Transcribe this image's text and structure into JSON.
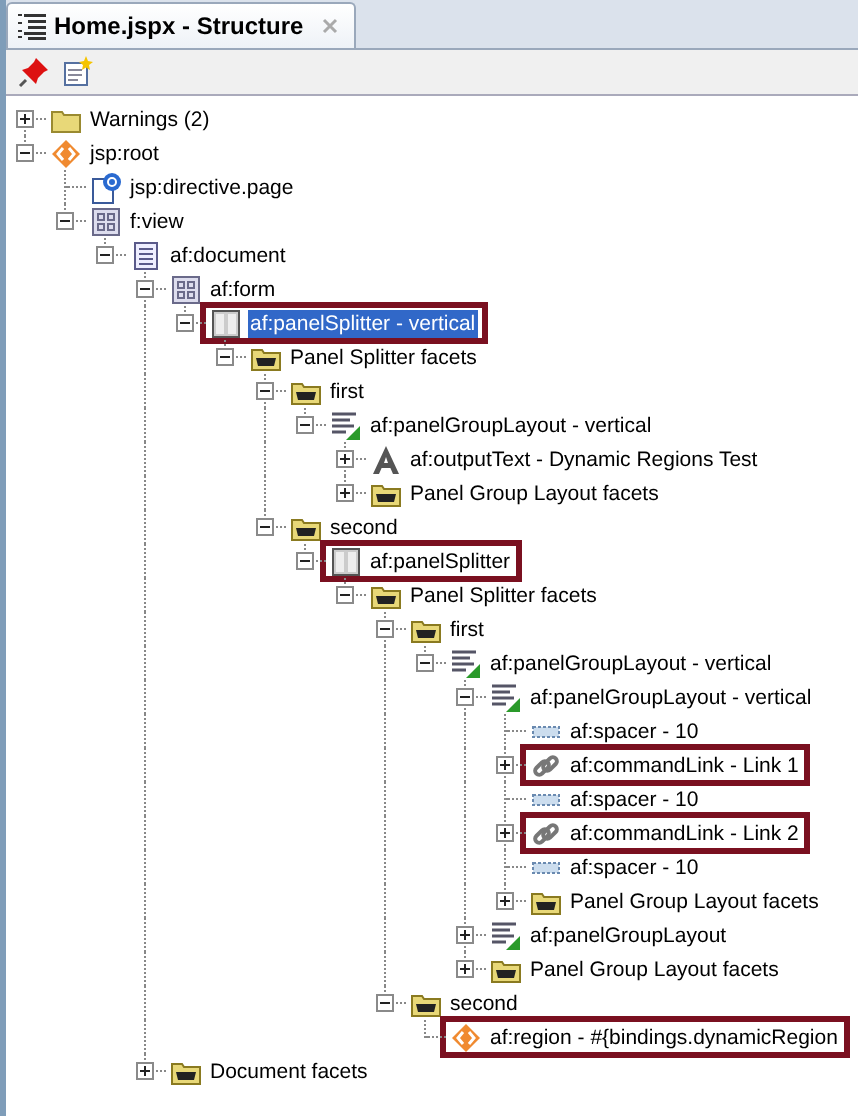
{
  "panel": {
    "title": "Home.jspx - Structure"
  },
  "tree": [
    {
      "label": "Warnings (2)",
      "kind": "folder",
      "expanded": false,
      "selected": false,
      "flagged": false
    },
    {
      "label": "jsp:root",
      "kind": "tag",
      "expanded": true,
      "selected": false,
      "flagged": false,
      "children": [
        {
          "label": "jsp:directive.page",
          "kind": "directive",
          "selected": false,
          "flagged": false
        },
        {
          "label": "f:view",
          "kind": "grid",
          "expanded": true,
          "selected": false,
          "flagged": false,
          "children": [
            {
              "label": "af:document",
              "kind": "doc",
              "expanded": true,
              "selected": false,
              "flagged": false,
              "children": [
                {
                  "label": "af:form",
                  "kind": "grid",
                  "expanded": true,
                  "selected": false,
                  "flagged": false,
                  "children": [
                    {
                      "label": "af:panelSplitter - vertical",
                      "kind": "splitter",
                      "expanded": true,
                      "selected": true,
                      "flagged": true,
                      "children": [
                        {
                          "label": "Panel Splitter facets",
                          "kind": "facet",
                          "expanded": true,
                          "selected": false,
                          "flagged": false,
                          "children": [
                            {
                              "label": "first",
                              "kind": "facet",
                              "expanded": true,
                              "selected": false,
                              "flagged": false,
                              "children": [
                                {
                                  "label": "af:panelGroupLayout - vertical",
                                  "kind": "layout",
                                  "expanded": true,
                                  "selected": false,
                                  "flagged": false,
                                  "children": [
                                    {
                                      "label": "af:outputText - Dynamic Regions Test",
                                      "kind": "text",
                                      "expanded": false,
                                      "selected": false,
                                      "flagged": false
                                    },
                                    {
                                      "label": "Panel Group Layout facets",
                                      "kind": "facet",
                                      "expanded": false,
                                      "selected": false,
                                      "flagged": false
                                    }
                                  ]
                                }
                              ]
                            },
                            {
                              "label": "second",
                              "kind": "facet",
                              "expanded": true,
                              "selected": false,
                              "flagged": false,
                              "children": [
                                {
                                  "label": "af:panelSplitter",
                                  "kind": "splitter",
                                  "expanded": true,
                                  "selected": false,
                                  "flagged": true,
                                  "children": [
                                    {
                                      "label": "Panel Splitter facets",
                                      "kind": "facet",
                                      "expanded": true,
                                      "selected": false,
                                      "flagged": false,
                                      "children": [
                                        {
                                          "label": "first",
                                          "kind": "facet",
                                          "expanded": true,
                                          "selected": false,
                                          "flagged": false,
                                          "children": [
                                            {
                                              "label": "af:panelGroupLayout - vertical",
                                              "kind": "layout",
                                              "expanded": true,
                                              "selected": false,
                                              "flagged": false,
                                              "children": [
                                                {
                                                  "label": "af:panelGroupLayout - vertical",
                                                  "kind": "layout",
                                                  "expanded": true,
                                                  "selected": false,
                                                  "flagged": false,
                                                  "children": [
                                                    {
                                                      "label": "af:spacer - 10",
                                                      "kind": "spacer",
                                                      "selected": false,
                                                      "flagged": false
                                                    },
                                                    {
                                                      "label": "af:commandLink - Link 1",
                                                      "kind": "link",
                                                      "expanded": false,
                                                      "selected": false,
                                                      "flagged": true
                                                    },
                                                    {
                                                      "label": "af:spacer - 10",
                                                      "kind": "spacer",
                                                      "selected": false,
                                                      "flagged": false
                                                    },
                                                    {
                                                      "label": "af:commandLink - Link 2",
                                                      "kind": "link",
                                                      "expanded": false,
                                                      "selected": false,
                                                      "flagged": true
                                                    },
                                                    {
                                                      "label": "af:spacer - 10",
                                                      "kind": "spacer",
                                                      "selected": false,
                                                      "flagged": false
                                                    },
                                                    {
                                                      "label": "Panel Group Layout facets",
                                                      "kind": "facet",
                                                      "expanded": false,
                                                      "selected": false,
                                                      "flagged": false
                                                    }
                                                  ]
                                                },
                                                {
                                                  "label": "af:panelGroupLayout",
                                                  "kind": "layout",
                                                  "expanded": false,
                                                  "selected": false,
                                                  "flagged": false
                                                },
                                                {
                                                  "label": "Panel Group Layout facets",
                                                  "kind": "facet",
                                                  "expanded": false,
                                                  "selected": false,
                                                  "flagged": false
                                                }
                                              ]
                                            }
                                          ]
                                        },
                                        {
                                          "label": "second",
                                          "kind": "facet",
                                          "expanded": true,
                                          "selected": false,
                                          "flagged": false,
                                          "children": [
                                            {
                                              "label": "af:region - #{bindings.dynamicRegion",
                                              "kind": "tag",
                                              "selected": false,
                                              "flagged": true
                                            }
                                          ]
                                        }
                                      ]
                                    }
                                  ]
                                }
                              ]
                            }
                          ]
                        }
                      ]
                    }
                  ]
                },
                {
                  "label": "Document facets",
                  "kind": "facet",
                  "expanded": false,
                  "selected": false,
                  "flagged": false
                }
              ]
            }
          ]
        }
      ]
    }
  ]
}
